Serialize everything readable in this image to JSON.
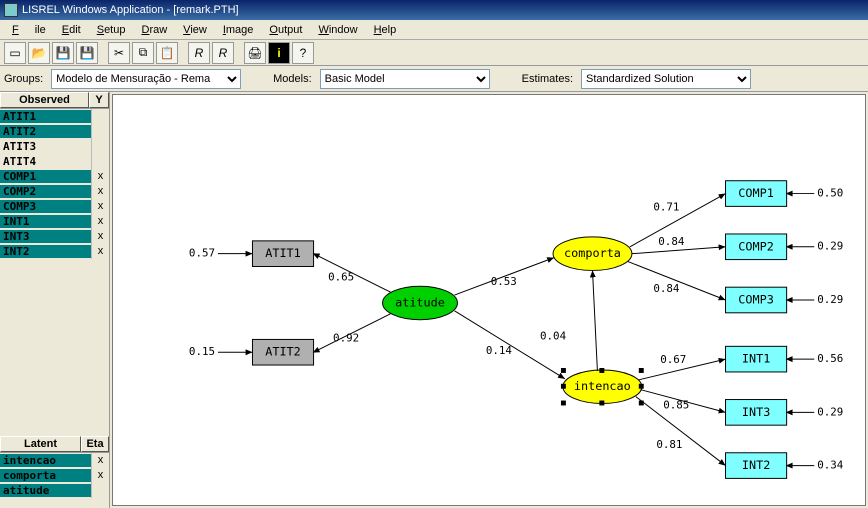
{
  "window": {
    "title": "LISREL Windows Application - [remark.PTH]"
  },
  "menu": {
    "items": [
      "File",
      "Edit",
      "Setup",
      "Draw",
      "View",
      "Image",
      "Output",
      "Window",
      "Help"
    ]
  },
  "toolbar": {
    "buttons": [
      "new",
      "open",
      "save",
      "save2",
      "cut",
      "copy",
      "paste",
      "run1",
      "run2",
      "print",
      "info",
      "help"
    ]
  },
  "selectors": {
    "groups_label": "Groups:",
    "groups_value": "Modelo de Mensuração - Rema",
    "models_label": "Models:",
    "models_value": "Basic Model",
    "estimates_label": "Estimates:",
    "estimates_value": "Standardized Solution"
  },
  "observed_panel": {
    "head1": "Observed",
    "head2": "Y",
    "rows": [
      {
        "name": "ATIT1",
        "teal": true,
        "chk": ""
      },
      {
        "name": "ATIT2",
        "teal": true,
        "chk": ""
      },
      {
        "name": "ATIT3",
        "teal": false,
        "chk": ""
      },
      {
        "name": "ATIT4",
        "teal": false,
        "chk": ""
      },
      {
        "name": "COMP1",
        "teal": true,
        "chk": "x"
      },
      {
        "name": "COMP2",
        "teal": true,
        "chk": "x"
      },
      {
        "name": "COMP3",
        "teal": true,
        "chk": "x"
      },
      {
        "name": "INT1",
        "teal": true,
        "chk": "x"
      },
      {
        "name": "INT3",
        "teal": true,
        "chk": "x"
      },
      {
        "name": "INT2",
        "teal": true,
        "chk": "x"
      }
    ]
  },
  "latent_panel": {
    "head1": "Latent",
    "head2": "Eta",
    "rows": [
      {
        "name": "intencao",
        "teal": true,
        "chk": "x"
      },
      {
        "name": "comporta",
        "teal": true,
        "chk": "x"
      },
      {
        "name": "atitude",
        "teal": true,
        "chk": ""
      }
    ]
  },
  "diagram": {
    "boxes": {
      "ATIT1": {
        "label": "ATIT1",
        "err": "0.57"
      },
      "ATIT2": {
        "label": "ATIT2",
        "err": "0.15"
      },
      "COMP1": {
        "label": "COMP1",
        "err": "0.50"
      },
      "COMP2": {
        "label": "COMP2",
        "err": "0.29"
      },
      "COMP3": {
        "label": "COMP3",
        "err": "0.29"
      },
      "INT1": {
        "label": "INT1",
        "err": "0.56"
      },
      "INT3": {
        "label": "INT3",
        "err": "0.29"
      },
      "INT2": {
        "label": "INT2",
        "err": "0.34"
      }
    },
    "latents": {
      "atitude": {
        "label": "atitude"
      },
      "comporta": {
        "label": "comporta"
      },
      "intencao": {
        "label": "intencao"
      }
    },
    "loadings": {
      "atit1": "0.65",
      "atit2": "0.92",
      "comp1": "0.71",
      "comp2": "0.84",
      "comp3": "0.84",
      "int1": "0.67",
      "int3": "0.85",
      "int2": "0.81",
      "ac_comp": "0.53",
      "ac_int": "0.14",
      "int_comp": "0.04"
    }
  }
}
